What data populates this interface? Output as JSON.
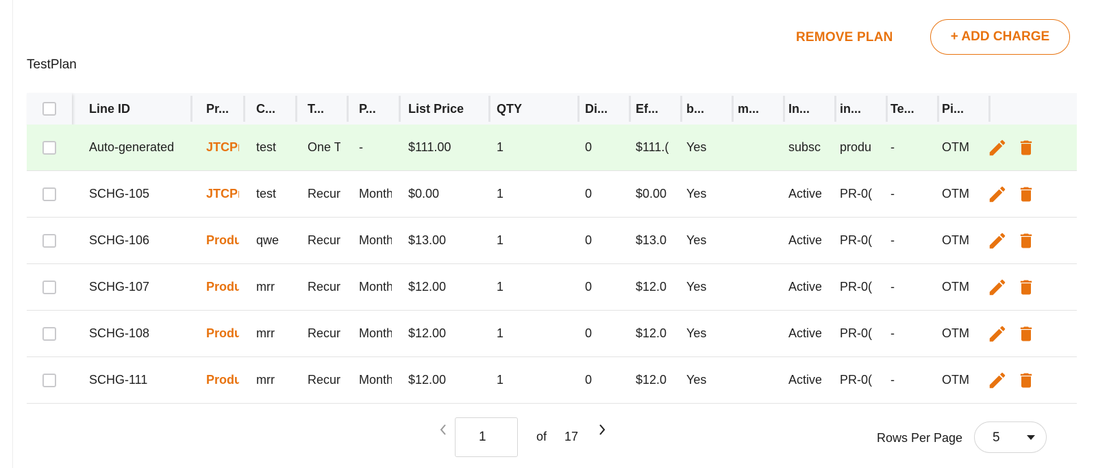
{
  "actions": {
    "remove_plan": "REMOVE PLAN",
    "add_charge": "+ ADD CHARGE"
  },
  "plan": {
    "title": "TestPlan"
  },
  "colors": {
    "accent": "#e8730f",
    "highlight_row": "#e8fbe6",
    "header_bg": "#f7f8fa"
  },
  "table": {
    "headers": [
      "Line ID",
      "Pr...",
      "C...",
      "T...",
      "P...",
      "List Price",
      "QTY",
      "Di...",
      "Ef...",
      "b...",
      "m...",
      "In...",
      "in...",
      "Te...",
      "Pi..."
    ],
    "rows": [
      {
        "line_id": "Auto-generated",
        "product": "JTCPr",
        "charge": "test",
        "type": "One T",
        "period": "-",
        "list_price": "$111.00",
        "qty": "1",
        "discount": "0",
        "effective": "$111.(",
        "b": "Yes",
        "m": "",
        "In": "subsc",
        "in": "produ",
        "te": "-",
        "pi": "OTM",
        "highlight": true
      },
      {
        "line_id": "SCHG-105",
        "product": "JTCPr",
        "charge": "test",
        "type": "Recur",
        "period": "Month",
        "list_price": "$0.00",
        "qty": "1",
        "discount": "0",
        "effective": "$0.00",
        "b": "Yes",
        "m": "",
        "In": "Active",
        "in": "PR-0(",
        "te": "-",
        "pi": "OTM",
        "highlight": false
      },
      {
        "line_id": "SCHG-106",
        "product": "Produ",
        "charge": "qwe",
        "type": "Recur",
        "period": "Month",
        "list_price": "$13.00",
        "qty": "1",
        "discount": "0",
        "effective": "$13.0",
        "b": "Yes",
        "m": "",
        "In": "Active",
        "in": "PR-0(",
        "te": "-",
        "pi": "OTM",
        "highlight": false
      },
      {
        "line_id": "SCHG-107",
        "product": "Produ",
        "charge": "mrr",
        "type": "Recur",
        "period": "Month",
        "list_price": "$12.00",
        "qty": "1",
        "discount": "0",
        "effective": "$12.0",
        "b": "Yes",
        "m": "",
        "In": "Active",
        "in": "PR-0(",
        "te": "-",
        "pi": "OTM",
        "highlight": false
      },
      {
        "line_id": "SCHG-108",
        "product": "Produ",
        "charge": "mrr",
        "type": "Recur",
        "period": "Month",
        "list_price": "$12.00",
        "qty": "1",
        "discount": "0",
        "effective": "$12.0",
        "b": "Yes",
        "m": "",
        "In": "Active",
        "in": "PR-0(",
        "te": "-",
        "pi": "OTM",
        "highlight": false
      },
      {
        "line_id": "SCHG-111",
        "product": "Produ",
        "charge": "mrr",
        "type": "Recur",
        "period": "Month",
        "list_price": "$12.00",
        "qty": "1",
        "discount": "0",
        "effective": "$12.0",
        "b": "Yes",
        "m": "",
        "In": "Active",
        "in": "PR-0(",
        "te": "-",
        "pi": "OTM",
        "highlight": false
      }
    ]
  },
  "pagination": {
    "current_page": "1",
    "of_label": "of",
    "total_pages": "17",
    "rows_per_page_label": "Rows Per Page",
    "rows_per_page": "5"
  },
  "icons": {
    "edit": "pencil-icon",
    "delete": "trash-icon",
    "prev": "chevron-left-icon",
    "next": "chevron-right-icon",
    "select": "caret-down-icon"
  }
}
